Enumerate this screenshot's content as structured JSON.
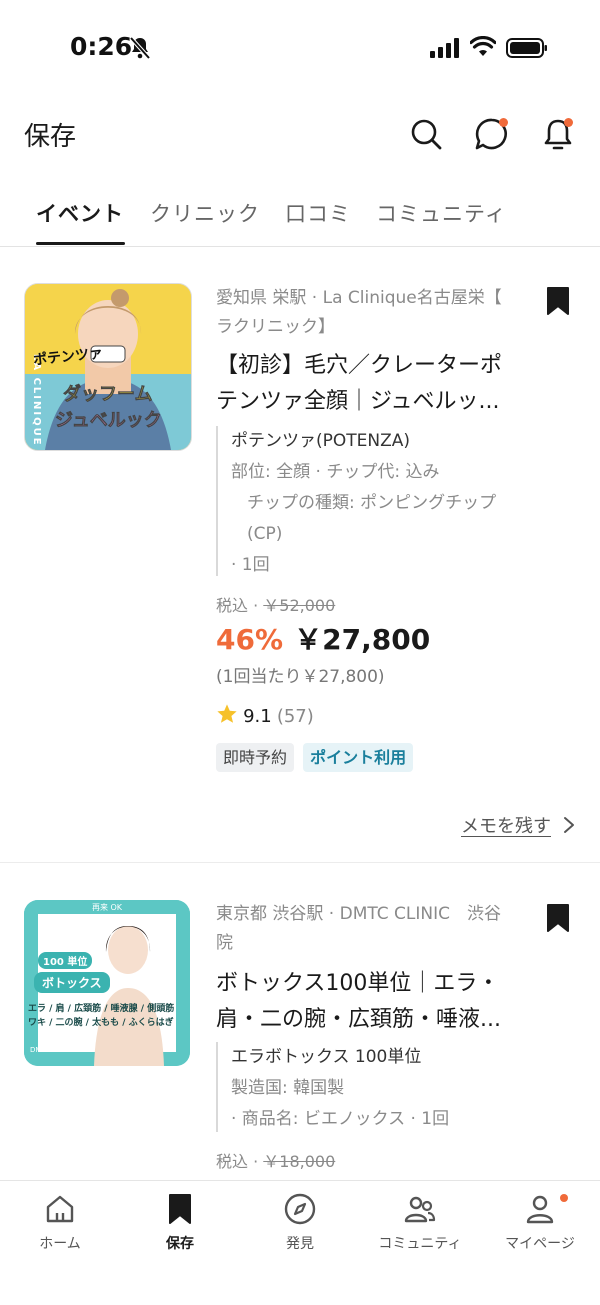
{
  "status": {
    "time": "0:26"
  },
  "header": {
    "title": "保存"
  },
  "tabs": [
    {
      "label": "イベント"
    },
    {
      "label": "クリニック"
    },
    {
      "label": "口コミ"
    },
    {
      "label": "コミュニティ"
    }
  ],
  "cards": [
    {
      "thumb_text": {
        "brand": "LA CLINIQUE",
        "a": "ポテンツァ",
        "b": "ダッフーム",
        "c": "ジュベルック"
      },
      "clinic_line1": "愛知県 栄駅 · La Clinique名古屋栄【",
      "clinic_line2": "ラクリニック】",
      "title_line1": "【初診】毛穴／クレーターポ",
      "title_line2": "テンツァ全顔｜ジュベルッ...",
      "details": [
        "ポテンツァ(POTENZA)",
        "部位: 全顔 · チップ代: 込み",
        "チップの種類: ポンピングチップ",
        "(CP)",
        "· 1回"
      ],
      "tax_label": "税込 ·",
      "original_price": "￥52,000",
      "discount": "46%",
      "price": "￥27,800",
      "unit_price": "(1回当たり￥27,800)",
      "rating": "9.1",
      "rating_count": "(57)",
      "chips": [
        "即時予約",
        "ポイント利用"
      ],
      "memo": "メモを残す"
    },
    {
      "thumb_text": {
        "top": "再来 OK",
        "a": "100 単位",
        "b": "ボトックス",
        "c": "エラ / 肩 / 広頚筋 / 唾液腺 / 側頭筋",
        "d": "ワキ / 二の腕 / 太もも / ふくらはぎ",
        "logo": "DMTC"
      },
      "clinic_line1": "東京都 渋谷駅 · DMTC CLINIC　渋谷",
      "clinic_line2": "院",
      "title_line1": "ボトックス100単位｜エラ・",
      "title_line2": "肩・二の腕・広頚筋・唾液...",
      "details": [
        "エラボトックス 100単位",
        "製造国: 韓国製",
        "· 商品名: ビエノックス · 1回"
      ],
      "tax_label": "税込 ·",
      "original_price": "￥18,000"
    }
  ],
  "nav": [
    {
      "label": "ホーム"
    },
    {
      "label": "保存"
    },
    {
      "label": "発見"
    },
    {
      "label": "コミュニティ"
    },
    {
      "label": "マイページ"
    }
  ],
  "colors": {
    "accent": "#ef6b3a",
    "notification_dot": "#f06a3a",
    "chip_blue": "#1a7f9c",
    "thumb1_bg": "#f2d24a",
    "thumb2_bg": "#5cc7c4"
  }
}
